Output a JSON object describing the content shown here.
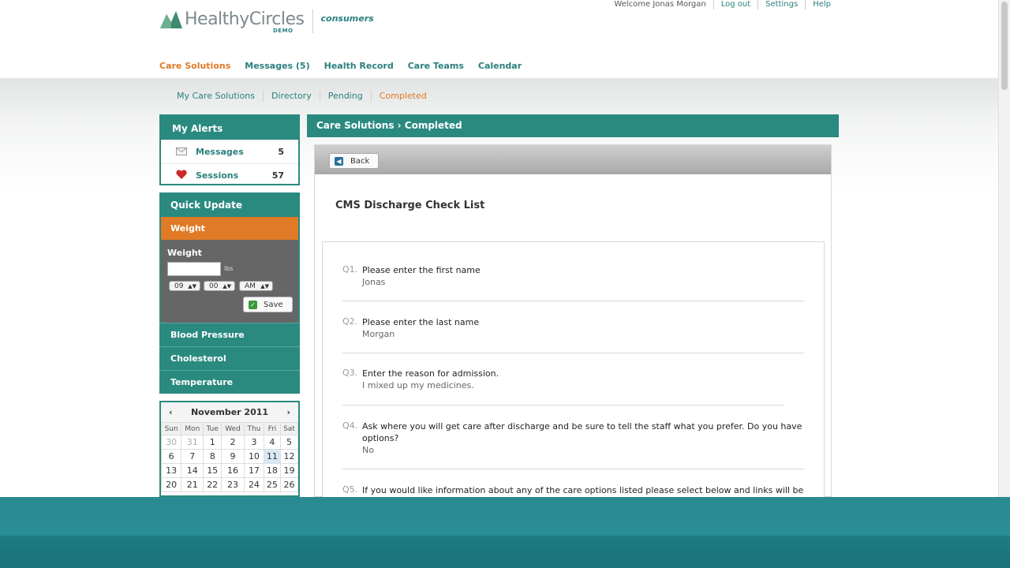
{
  "header": {
    "brand": "HealthyCircles",
    "brand_tag": "DEMO",
    "portal": "consumers",
    "welcome": "Welcome Jonas Morgan",
    "links": [
      "Log out",
      "Settings",
      "Help"
    ]
  },
  "main_nav": [
    "Care Solutions",
    "Messages (5)",
    "Health Record",
    "Care Teams",
    "Calendar"
  ],
  "main_nav_active": "Care Solutions",
  "sub_nav": [
    "My Care Solutions",
    "Directory",
    "Pending",
    "Completed"
  ],
  "sub_nav_active": "Completed",
  "alerts": {
    "title": "My Alerts",
    "items": [
      {
        "label": "Messages",
        "count": "5",
        "icon": "envelope-icon"
      },
      {
        "label": "Sessions",
        "count": "57",
        "icon": "heart-icon"
      }
    ]
  },
  "quick_update": {
    "title": "Quick Update",
    "active_tab": "Weight",
    "weight_label": "Weight",
    "unit": "lbs",
    "hour": "09",
    "minute": "00",
    "ampm": "AM",
    "save_label": "Save",
    "other_tabs": [
      "Blood Pressure",
      "Cholesterol",
      "Temperature"
    ]
  },
  "calendar": {
    "month": "November 2011",
    "prev": "‹",
    "next": "›",
    "dow": [
      "Sun",
      "Mon",
      "Tue",
      "Wed",
      "Thu",
      "Fri",
      "Sat"
    ],
    "weeks": [
      [
        "30",
        "31",
        "1",
        "2",
        "3",
        "4",
        "5"
      ],
      [
        "6",
        "7",
        "8",
        "9",
        "10",
        "11",
        "12"
      ],
      [
        "13",
        "14",
        "15",
        "16",
        "17",
        "18",
        "19"
      ],
      [
        "20",
        "21",
        "22",
        "23",
        "24",
        "25",
        "26"
      ]
    ],
    "today": "11"
  },
  "content": {
    "breadcrumb": "Care Solutions › Completed",
    "back_label": "Back",
    "title": "CMS Discharge Check List",
    "questions": [
      {
        "num": "Q1.",
        "text": "Please enter the first name",
        "answer": "Jonas"
      },
      {
        "num": "Q2.",
        "text": "Please enter the last name",
        "answer": "Morgan"
      },
      {
        "num": "Q3.",
        "text": "Enter the reason for admission.",
        "answer": "I mixed up my medicines."
      },
      {
        "num": "Q4.",
        "text": "Ask where you will get care after discharge and be sure to tell the staff what you prefer. Do you have options?",
        "answer": "No"
      },
      {
        "num": "Q5.",
        "text": "If you would like information about any of the care options listed please select below and links will be sent",
        "answer": ""
      }
    ]
  },
  "colors": {
    "accent": "#2a8a80",
    "active": "#e07a26",
    "text_link": "#2a7f7e",
    "bottom_band": "#2a8a91"
  }
}
